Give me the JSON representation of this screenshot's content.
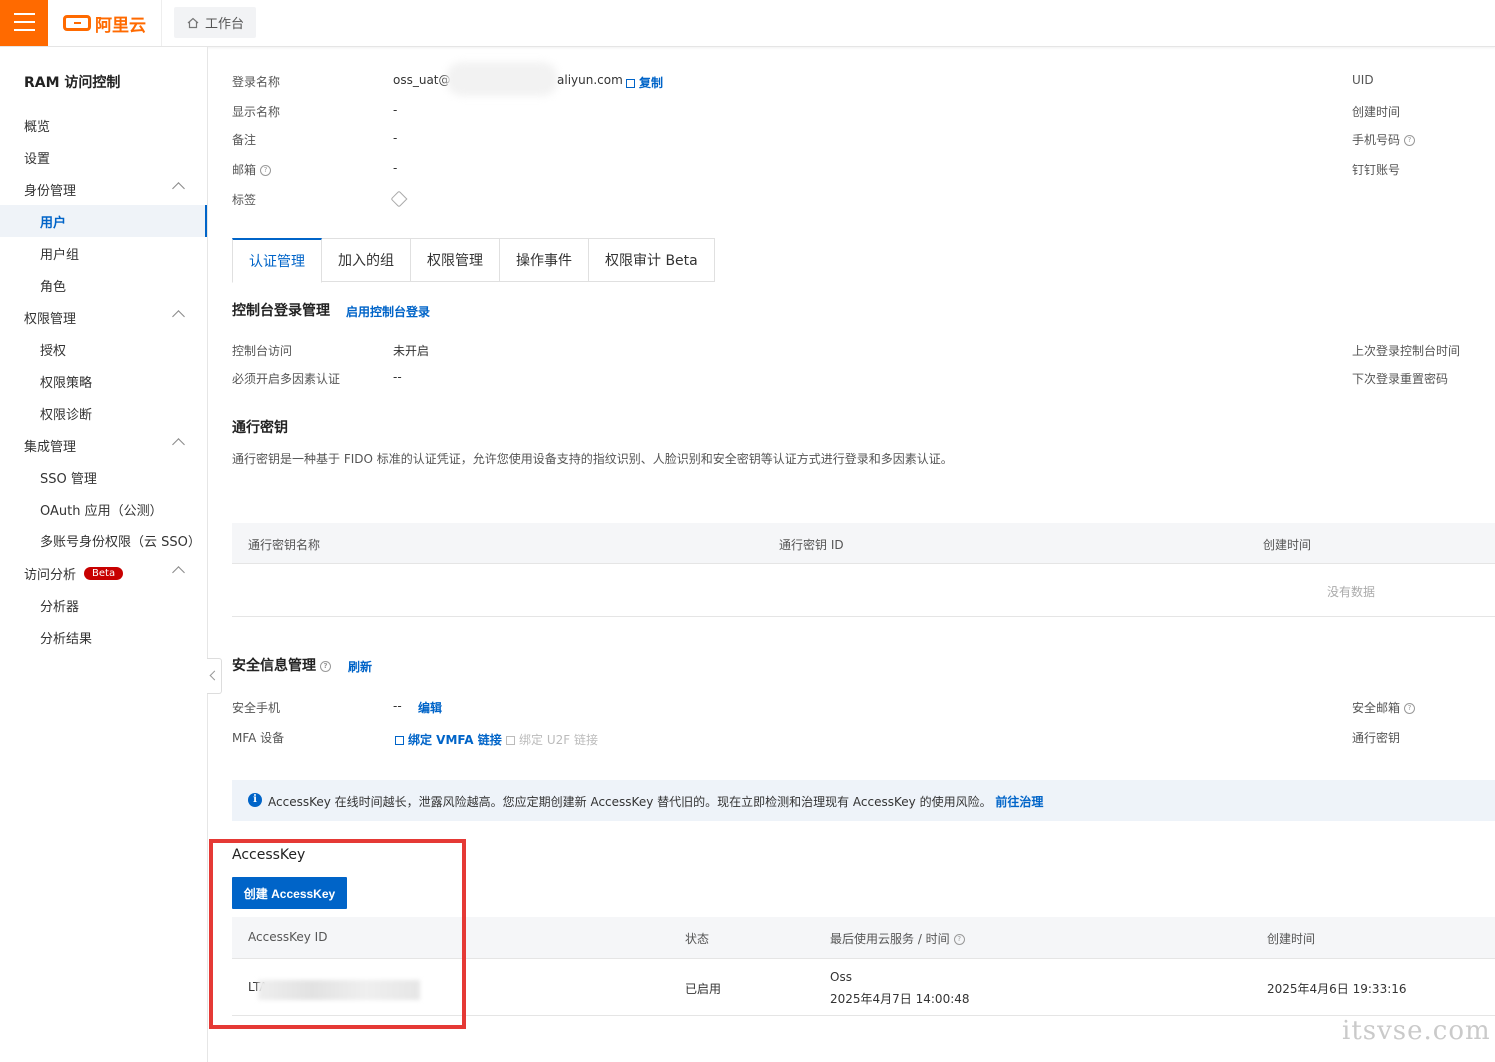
{
  "header": {
    "brand": "阿里云",
    "workbench": "工作台"
  },
  "sidebar": {
    "title": "RAM 访问控制",
    "items": [
      {
        "label": "概览"
      },
      {
        "label": "设置"
      },
      {
        "label": "身份管理"
      },
      {
        "label": "用户"
      },
      {
        "label": "用户组"
      },
      {
        "label": "角色"
      },
      {
        "label": "权限管理"
      },
      {
        "label": "授权"
      },
      {
        "label": "权限策略"
      },
      {
        "label": "权限诊断"
      },
      {
        "label": "集成管理"
      },
      {
        "label": "SSO 管理"
      },
      {
        "label": "OAuth 应用（公测）"
      },
      {
        "label": "多账号身份权限（云 SSO）"
      },
      {
        "label": "访问分析",
        "badge": "Beta"
      },
      {
        "label": "分析器"
      },
      {
        "label": "分析结果"
      }
    ]
  },
  "user_info": {
    "login_name_label": "登录名称",
    "login_name_prefix": "oss_uat@",
    "login_name_suffix": "aliyun.com",
    "copy_label": "复制",
    "display_name_label": "显示名称",
    "display_name": "-",
    "remark_label": "备注",
    "remark": "-",
    "email_label": "邮箱",
    "email": "-",
    "tags_label": "标签",
    "uid_label": "UID",
    "created_label": "创建时间",
    "phone_label": "手机号码",
    "dingtalk_label": "钉钉账号"
  },
  "tabs": [
    "认证管理",
    "加入的组",
    "权限管理",
    "操作事件",
    "权限审计 Beta"
  ],
  "console_login": {
    "title": "控制台登录管理",
    "enable_link": "启用控制台登录",
    "access_label": "控制台访问",
    "access_value": "未开启",
    "mfa_required_label": "必须开启多因素认证",
    "mfa_required_value": "--",
    "last_login_label": "上次登录控制台时间",
    "reset_pw_label": "下次登录重置密码"
  },
  "passkey": {
    "title": "通行密钥",
    "desc": "通行密钥是一种基于 FIDO 标准的认证凭证，允许您使用设备支持的指纹识别、人脸识别和安全密钥等认证方式进行登录和多因素认证。",
    "columns": [
      "通行密钥名称",
      "通行密钥 ID",
      "创建时间"
    ],
    "empty": "没有数据"
  },
  "security": {
    "title": "安全信息管理",
    "refresh": "刷新",
    "phone_label": "安全手机",
    "phone_value": "--",
    "edit": "编辑",
    "mfa_label": "MFA 设备",
    "bind_vmfa": "绑定 VMFA 链接",
    "bind_u2f": "绑定 U2F 链接",
    "email_label": "安全邮箱",
    "passkey_label": "通行密钥"
  },
  "notice": {
    "text": "AccessKey 在线时间越长，泄露风险越高。您应定期创建新 AccessKey 替代旧的。现在立即检测和治理现有 AccessKey 的使用风险。",
    "link": "前往治理"
  },
  "accesskey": {
    "title": "AccessKey",
    "create_button": "创建 AccessKey",
    "columns": [
      "AccessKey ID",
      "状态",
      "最后使用云服务 / 时间",
      "创建时间"
    ],
    "rows": [
      {
        "id": "LTA",
        "status": "已启用",
        "last_service": "Oss",
        "last_time": "2025年4月7日 14:00:48",
        "created": "2025年4月6日 19:33:16"
      }
    ]
  },
  "watermark": "itsvse.com",
  "colors": {
    "brand": "#ff6a00",
    "primary": "#0064c8",
    "highlight_box": "#e53935"
  }
}
